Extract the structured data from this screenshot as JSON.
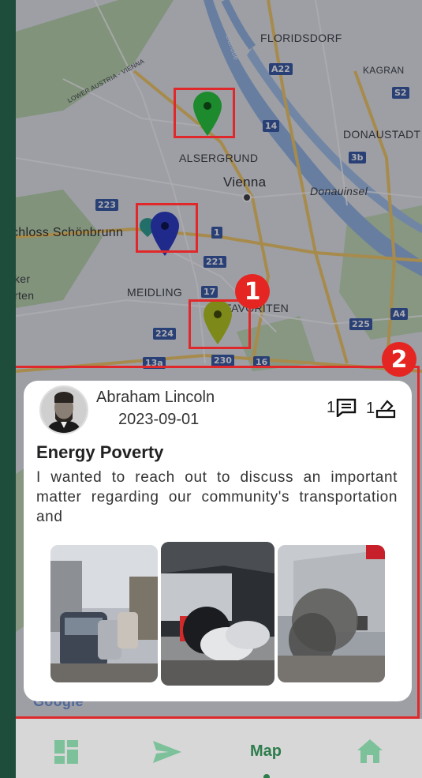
{
  "map": {
    "labels": {
      "floridsdorf": "FLORIDSDORF",
      "kagran": "KAGRAN",
      "donaustadt": "DONAUSTADT",
      "alsergrund": "ALSERGRUND",
      "vienna": "Vienna",
      "donauinsel": "Donauinsel",
      "schoenbrunn": "chloss Schönbrunn",
      "meidling": "MEIDLING",
      "favoriten": "FAVORITEN",
      "lower_austria": "LOWER AUSTRIA - VIENNA",
      "danube": "Danube",
      "ker": "ker",
      "rten": "rten",
      "google": "Google"
    },
    "shields": {
      "a22": "A22",
      "s2": "S2",
      "n14": "14",
      "n3b": "3b",
      "n223": "223",
      "n1": "1",
      "n221": "221",
      "n17": "17",
      "n224": "224",
      "n225": "225",
      "a4": "A4",
      "n230": "230",
      "n16": "16",
      "n13a": "13a"
    },
    "pins": [
      {
        "name": "green",
        "color": "#1e8a2e"
      },
      {
        "name": "navy",
        "color": "#1f2a8a"
      },
      {
        "name": "olive",
        "color": "#7d8a1a"
      }
    ]
  },
  "annotations": {
    "badge1": "1",
    "badge2": "2"
  },
  "card": {
    "author": "Abraham Lincoln",
    "date": "2023-09-01",
    "comments_count": "1",
    "votes_count": "1",
    "title": "Energy Poverty",
    "body": "I wanted to reach out to discuss an important matter regarding our community's transportation and"
  },
  "nav": {
    "active_label": "Map",
    "active_color": "#2e7d4c"
  }
}
